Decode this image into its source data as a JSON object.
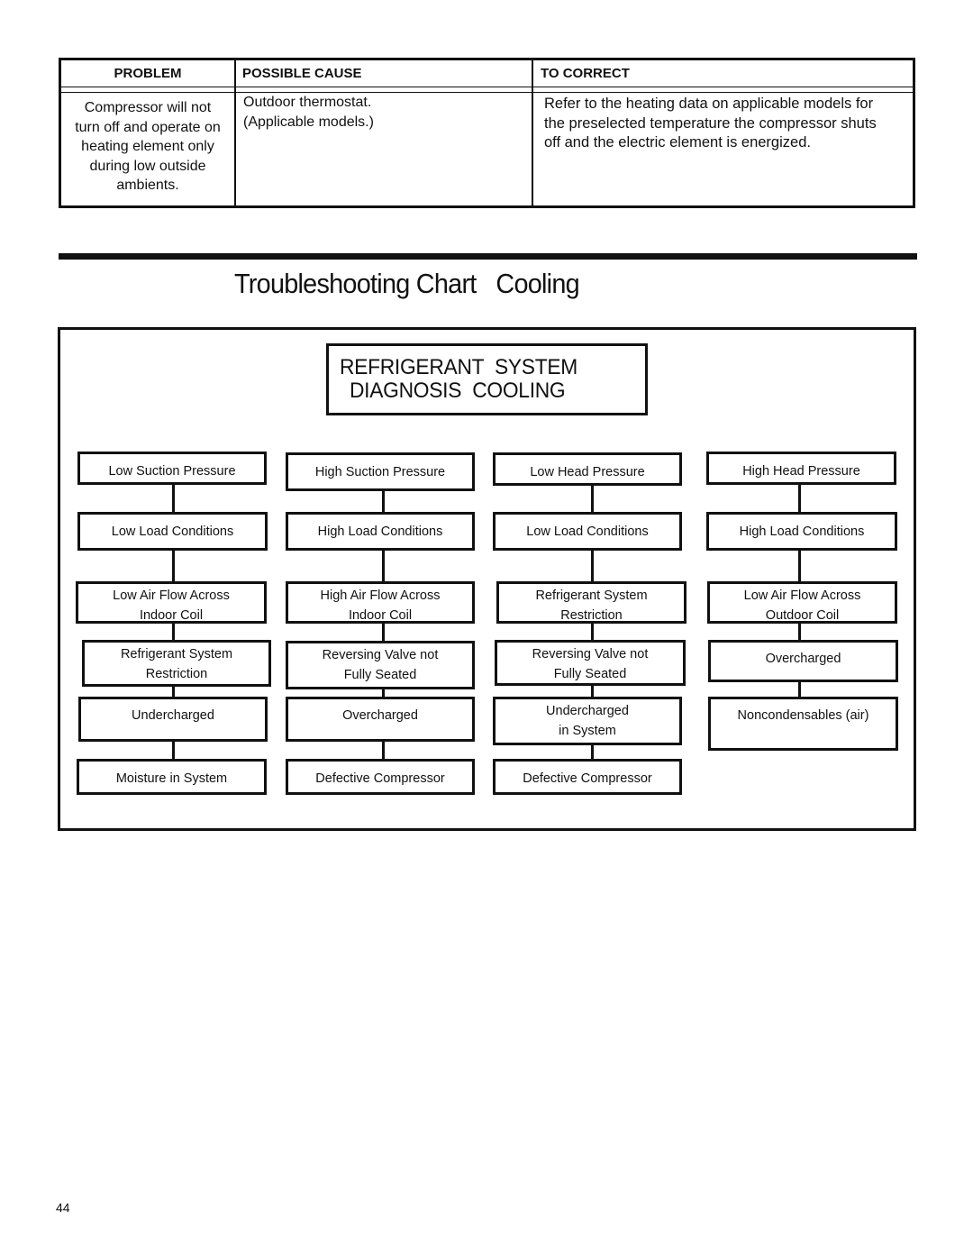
{
  "table": {
    "headers": [
      "PROBLEM",
      "POSSIBLE CAUSE",
      "TO CORRECT"
    ],
    "rows": [
      {
        "problem": [
          "Compressor will not",
          "turn off and operate on",
          "heating element only",
          "during low outside",
          "ambients."
        ],
        "cause": [
          "Outdoor thermostat.",
          "(Applicable models.)"
        ],
        "correct": [
          "Refer to the heating data on applicable models for",
          "the preselected temperature the compressor shuts",
          "off and the electric element is energized."
        ]
      }
    ]
  },
  "section_title": "Troubleshooting Chart   Cooling",
  "diagnosis": {
    "title_line1": "REFRIGERANT  SYSTEM",
    "title_line2": "DIAGNOSIS  COOLING",
    "columns": [
      {
        "name": "low-suction",
        "boxes": [
          [
            "Low Suction Pressure"
          ],
          [
            "Low Load Conditions"
          ],
          [
            "Low Air Flow Across",
            "Indoor Coil"
          ],
          [
            "Refrigerant System",
            "Restriction"
          ],
          [
            "Undercharged"
          ],
          [
            "Moisture in System"
          ]
        ]
      },
      {
        "name": "high-suction",
        "boxes": [
          [
            "High Suction Pressure"
          ],
          [
            "High Load Conditions"
          ],
          [
            "High Air Flow Across",
            "Indoor Coil"
          ],
          [
            "Reversing Valve not",
            "Fully Seated"
          ],
          [
            "Overcharged"
          ],
          [
            "Defective Compressor"
          ]
        ]
      },
      {
        "name": "low-head",
        "boxes": [
          [
            "Low Head Pressure"
          ],
          [
            "Low Load Conditions"
          ],
          [
            "Refrigerant System",
            "Restriction"
          ],
          [
            "Reversing Valve not",
            "Fully Seated"
          ],
          [
            "Undercharged",
            "in System"
          ],
          [
            "Defective Compressor"
          ]
        ]
      },
      {
        "name": "high-head",
        "boxes": [
          [
            "High Head Pressure"
          ],
          [
            "High Load Conditions"
          ],
          [
            "Low Air Flow Across",
            "Outdoor Coil"
          ],
          [
            "Overcharged"
          ],
          [
            "Noncondensables (air)"
          ]
        ]
      }
    ]
  },
  "page_number": "44"
}
